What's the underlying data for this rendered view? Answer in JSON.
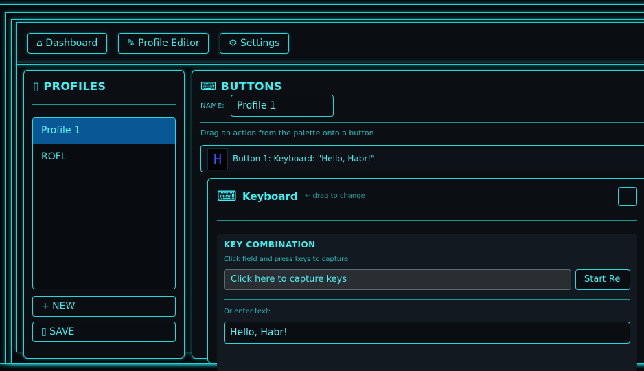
{
  "nav": {
    "dashboard_label": "⌂ Dashboard",
    "profile_editor_label": "✎ Profile Editor",
    "settings_label": "⚙ Settings"
  },
  "profiles_panel": {
    "title": "▯ PROFILES",
    "items": [
      {
        "label": "Profile 1",
        "selected": true
      },
      {
        "label": "ROFL",
        "selected": false
      }
    ],
    "new_label": "+ NEW",
    "save_label": "▯ SAVE"
  },
  "buttons_panel": {
    "title": "⌨ BUTTONS",
    "name_label": "NAME:",
    "name_value": "Profile 1",
    "drag_hint": "Drag an action from the palette onto a button",
    "button_row": {
      "thumb_glyph": "H",
      "label": "Button 1: Keyboard: \"Hello, Habr!\""
    },
    "action": {
      "icon": "⌨",
      "title": "Keyboard",
      "drag_hint": "← drag to change",
      "key_combination": {
        "title": "KEY COMBINATION",
        "hint": "Click field and press keys to capture",
        "capture_text": "Click here to capture keys",
        "start_label": "Start Re",
        "text_label": "Or enter text:",
        "text_value": "Hello, Habr!"
      }
    }
  },
  "colors": {
    "accent": "#2ee6e6",
    "selected": "#0a5795",
    "background": "#05080c"
  }
}
